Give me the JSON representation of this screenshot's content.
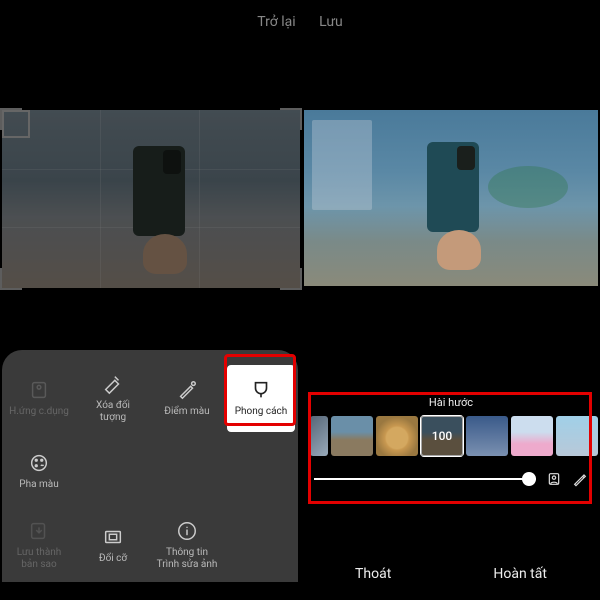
{
  "header": {
    "back": "Trở lại",
    "save": "Lưu"
  },
  "tools": {
    "effect": "H.ứng c.dụng",
    "erase": "Xóa đối\ntượng",
    "spot": "Điểm màu",
    "style": "Phong cách",
    "mix": "Pha màu",
    "saveas": "Lưu thành\nbản sao",
    "resize": "Đổi cỡ",
    "info": "Thông tin\nTrình sửa ảnh"
  },
  "style_panel": {
    "title": "Hài hước",
    "intensity": "100"
  },
  "actions": {
    "exit": "Thoát",
    "done": "Hoàn tất"
  }
}
